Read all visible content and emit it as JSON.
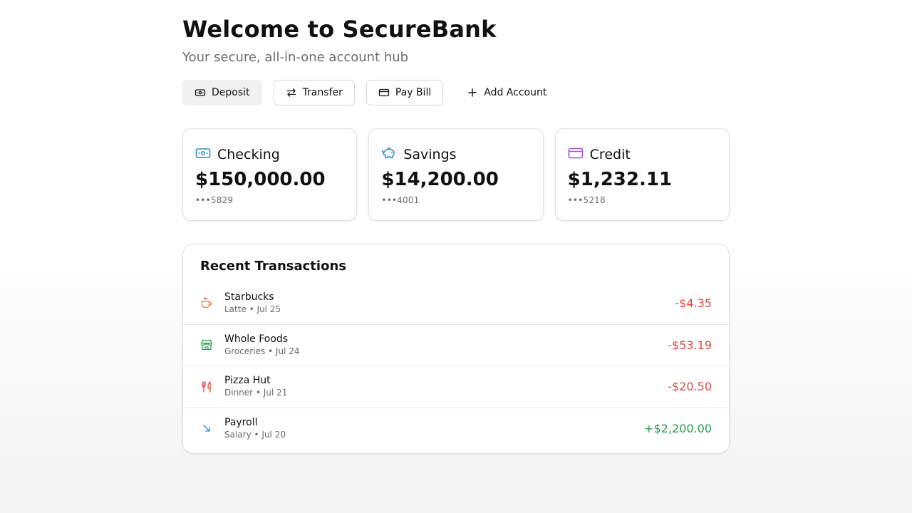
{
  "header": {
    "title": "Welcome to SecureBank",
    "subtitle": "Your secure, all-in-one account hub"
  },
  "actions": [
    {
      "label": "Deposit",
      "icon": "cash-icon"
    },
    {
      "label": "Transfer",
      "icon": "transfer-icon"
    },
    {
      "label": "Pay Bill",
      "icon": "card-icon"
    },
    {
      "label": "Add Account",
      "icon": "plus-icon"
    }
  ],
  "accounts": [
    {
      "name": "Checking",
      "balance": "$150,000.00",
      "number": "•••5829",
      "icon": "cash-icon",
      "color": "#2b8fcf"
    },
    {
      "name": "Savings",
      "balance": "$14,200.00",
      "number": "•••4001",
      "icon": "piggy-bank-icon",
      "color": "#2b8fcf"
    },
    {
      "name": "Credit",
      "balance": "$1,232.11",
      "number": "•••5218",
      "icon": "credit-card-icon",
      "color": "#a64ed8"
    }
  ],
  "transactions": {
    "title": "Recent Transactions",
    "items": [
      {
        "merchant": "Starbucks",
        "meta": "Latte • Jul 25",
        "amount": "-$4.35",
        "type": "debit",
        "icon": "coffee-icon",
        "color": "#e8763a"
      },
      {
        "merchant": "Whole Foods",
        "meta": "Groceries • Jul 24",
        "amount": "-$53.19",
        "type": "debit",
        "icon": "store-icon",
        "color": "#2a9a4e"
      },
      {
        "merchant": "Pizza Hut",
        "meta": "Dinner • Jul 21",
        "amount": "-$20.50",
        "type": "debit",
        "icon": "utensils-icon",
        "color": "#e0483e"
      },
      {
        "merchant": "Payroll",
        "meta": "Salary • Jul 20",
        "amount": "+$2,200.00",
        "type": "credit",
        "icon": "arrow-down-right-icon",
        "color": "#2b8fcf"
      }
    ]
  },
  "colors": {
    "negative": "#e0483e",
    "positive": "#20a04a"
  }
}
